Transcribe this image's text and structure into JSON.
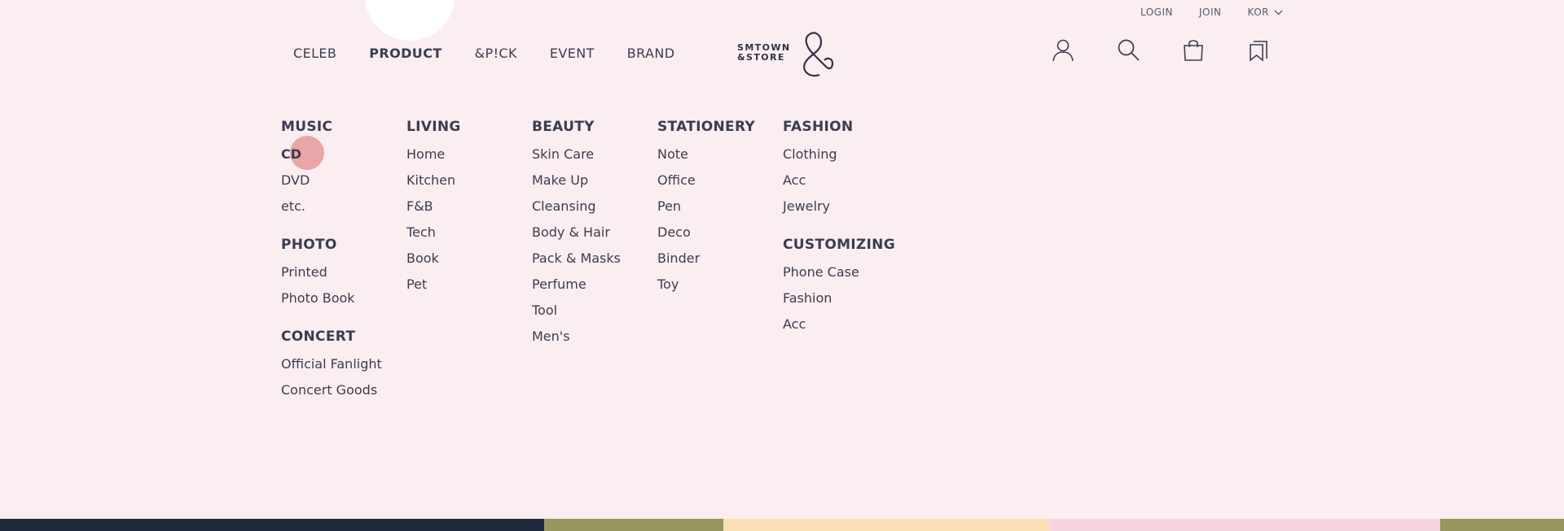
{
  "topbar": {
    "login": "LOGIN",
    "join": "JOIN",
    "lang": "KOR"
  },
  "nav": [
    {
      "label": "CELEB"
    },
    {
      "label": "PRODUCT"
    },
    {
      "label": "&P!CK"
    },
    {
      "label": "EVENT"
    },
    {
      "label": "BRAND"
    }
  ],
  "logo": {
    "line1": "SMTOWN",
    "line2": "&STORE"
  },
  "icons": [
    "user-icon",
    "search-icon",
    "shopping-bag-icon",
    "bookmark-icon"
  ],
  "menu": {
    "music": {
      "title": "MUSIC",
      "items": [
        "CD",
        "DVD",
        "etc."
      ]
    },
    "photo": {
      "title": "PHOTO",
      "items": [
        "Printed",
        "Photo Book"
      ]
    },
    "concert": {
      "title": "CONCERT",
      "items": [
        "Official Fanlight",
        "Concert Goods"
      ]
    },
    "living": {
      "title": "LIVING",
      "items": [
        "Home",
        "Kitchen",
        "F&B",
        "Tech",
        "Book",
        "Pet"
      ]
    },
    "beauty": {
      "title": "BEAUTY",
      "items": [
        "Skin Care",
        "Make Up",
        "Cleansing",
        "Body & Hair",
        "Pack & Masks",
        "Perfume",
        "Tool",
        "Men's"
      ]
    },
    "stationery": {
      "title": "STATIONERY",
      "items": [
        "Note",
        "Office",
        "Pen",
        "Deco",
        "Binder",
        "Toy"
      ]
    },
    "fashion": {
      "title": "FASHION",
      "items": [
        "Clothing",
        "Acc",
        "Jewelry"
      ]
    },
    "customizing": {
      "title": "CUSTOMIZING",
      "items": [
        "Phone Case",
        "Fashion",
        "Acc"
      ]
    }
  },
  "colors": {
    "background": "#fbeef0",
    "text": "#3a3d52",
    "highlight": "#e5999c"
  }
}
